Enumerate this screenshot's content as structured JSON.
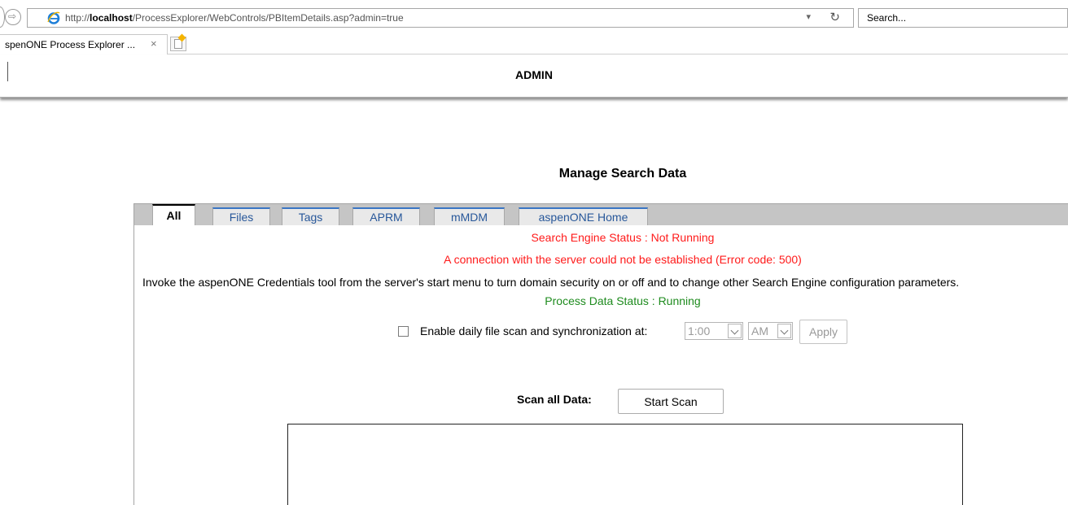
{
  "browser": {
    "url_prefix": "http://",
    "url_host": "localhost",
    "url_path": "/ProcessExplorer/WebControls/PBItemDetails.asp?admin=true",
    "search_placeholder": "Search...",
    "tab_title": "spenONE Process Explorer ...",
    "tab_close": "×"
  },
  "header": {
    "title": "ADMIN"
  },
  "page": {
    "heading": "Manage Search Data",
    "tabs": [
      {
        "label": "All",
        "active": true
      },
      {
        "label": "Files",
        "active": false
      },
      {
        "label": "Tags",
        "active": false
      },
      {
        "label": "APRM",
        "active": false
      },
      {
        "label": "mMDM",
        "active": false
      },
      {
        "label": "aspenONE Home",
        "active": false
      }
    ],
    "search_engine_status": "Search Engine Status : Not Running",
    "connection_error": "A connection with the server could not be established (Error code: 500)",
    "invoke_message": "Invoke the aspenONE Credentials tool from the server's start menu to turn domain security on or off and to change other Search Engine configuration parameters.",
    "process_data_status": "Process Data Status : Running",
    "schedule": {
      "label": "Enable daily file scan and synchronization at:",
      "checked": false,
      "time_value": "1:00",
      "ampm_value": "AM",
      "apply_label": "Apply"
    },
    "scan": {
      "label": "Scan all Data:",
      "button_label": "Start Scan"
    }
  },
  "colors": {
    "error_red": "#ff1a1a",
    "ok_green": "#1e8b1e",
    "tab_blue": "#3a75c4"
  }
}
